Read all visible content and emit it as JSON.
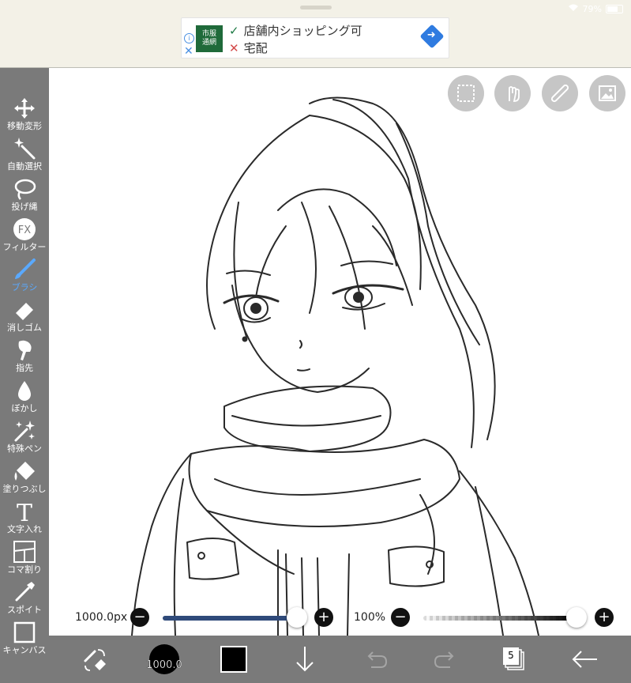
{
  "status": {
    "battery": "79%"
  },
  "ad": {
    "logo_text": "市場\n通販",
    "line1": "店舗内ショッピング可",
    "line2": "宅配",
    "info_icon": "info-icon",
    "close_icon": "close-icon",
    "directions_icon": "directions-icon"
  },
  "tools": [
    {
      "id": "move",
      "label": "移動変形",
      "icon": "move-icon"
    },
    {
      "id": "magic-wand",
      "label": "自動選択",
      "icon": "magic-wand-icon"
    },
    {
      "id": "lasso",
      "label": "投げ縄",
      "icon": "lasso-icon"
    },
    {
      "id": "filter",
      "label": "フィルター",
      "icon": "fx-icon",
      "icon_text": "FX"
    },
    {
      "id": "brush",
      "label": "ブラシ",
      "icon": "brush-icon",
      "active": true
    },
    {
      "id": "eraser",
      "label": "消しゴム",
      "icon": "eraser-icon"
    },
    {
      "id": "smudge",
      "label": "指先",
      "icon": "finger-icon"
    },
    {
      "id": "blur",
      "label": "ぼかし",
      "icon": "drop-icon"
    },
    {
      "id": "special-pen",
      "label": "特殊ペン",
      "icon": "sparkle-pen-icon"
    },
    {
      "id": "fill",
      "label": "塗りつぶし",
      "icon": "bucket-icon"
    },
    {
      "id": "text",
      "label": "文字入れ",
      "icon": "text-icon",
      "icon_text": "T"
    },
    {
      "id": "panel",
      "label": "コマ割り",
      "icon": "panel-icon"
    },
    {
      "id": "eyedropper",
      "label": "スポイト",
      "icon": "eyedropper-icon"
    },
    {
      "id": "canvas",
      "label": "キャンバス",
      "icon": "canvas-icon"
    }
  ],
  "canvas_buttons": [
    "selection-icon",
    "hand-icon",
    "ruler-icon",
    "image-icon"
  ],
  "brush_size": {
    "value": "1000.0px",
    "level": 1.0
  },
  "opacity": {
    "value": "100%",
    "level": 1.0
  },
  "bottom": {
    "brush_preview_value": "1000.0",
    "layers_count": "5",
    "primary_color": "#000000",
    "accent": "#5aa9ff",
    "slider_fill": "#2f4a7a"
  }
}
